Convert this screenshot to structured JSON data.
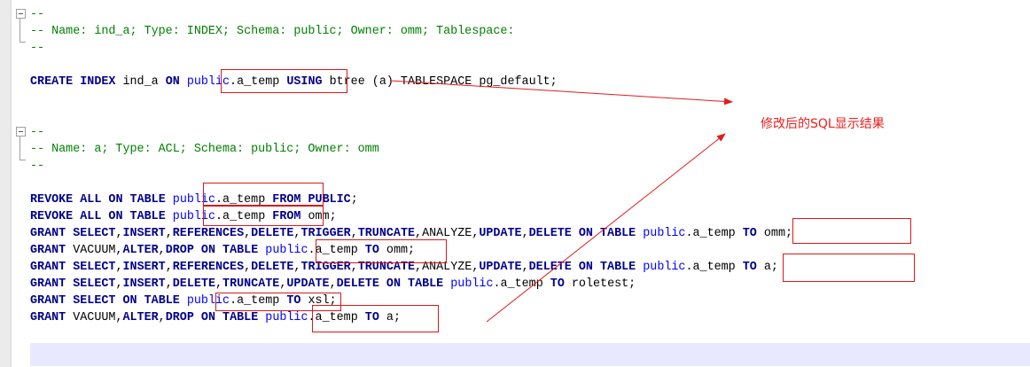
{
  "editor": {
    "lines": [
      {
        "row": 0,
        "tokens": [
          [
            "cm",
            "--"
          ]
        ]
      },
      {
        "row": 1,
        "tokens": [
          [
            "cm",
            "-- Name: ind_a; Type: INDEX; Schema: public; Owner: omm; Tablespace:"
          ]
        ]
      },
      {
        "row": 2,
        "tokens": [
          [
            "cm",
            "--"
          ]
        ]
      },
      {
        "row": 4,
        "tokens": [
          [
            "kw",
            "CREATE"
          ],
          [
            "pl",
            " "
          ],
          [
            "kw",
            "INDEX"
          ],
          [
            "pl",
            " ind_a "
          ],
          [
            "kw",
            "ON"
          ],
          [
            "pl",
            " "
          ],
          [
            "id",
            "public"
          ],
          [
            "pl",
            ".a_temp "
          ],
          [
            "kw",
            "USING"
          ],
          [
            "pl",
            " btree (a) TABLESPACE pg_default;"
          ]
        ]
      },
      {
        "row": 7,
        "tokens": [
          [
            "cm",
            "--"
          ]
        ]
      },
      {
        "row": 8,
        "tokens": [
          [
            "cm",
            "-- Name: a; Type: ACL; Schema: public; Owner: omm"
          ]
        ]
      },
      {
        "row": 9,
        "tokens": [
          [
            "cm",
            "--"
          ]
        ]
      },
      {
        "row": 11,
        "tokens": [
          [
            "kw",
            "REVOKE"
          ],
          [
            "pl",
            " "
          ],
          [
            "kw",
            "ALL"
          ],
          [
            "pl",
            " "
          ],
          [
            "kw",
            "ON"
          ],
          [
            "pl",
            " "
          ],
          [
            "kw",
            "TABLE"
          ],
          [
            "pl",
            " "
          ],
          [
            "id",
            "public"
          ],
          [
            "pl",
            ".a_temp "
          ],
          [
            "kw",
            "FROM"
          ],
          [
            "pl",
            " "
          ],
          [
            "kw",
            "PUBLIC"
          ],
          [
            "pl",
            ";"
          ]
        ]
      },
      {
        "row": 12,
        "tokens": [
          [
            "kw",
            "REVOKE"
          ],
          [
            "pl",
            " "
          ],
          [
            "kw",
            "ALL"
          ],
          [
            "pl",
            " "
          ],
          [
            "kw",
            "ON"
          ],
          [
            "pl",
            " "
          ],
          [
            "kw",
            "TABLE"
          ],
          [
            "pl",
            " "
          ],
          [
            "id",
            "public"
          ],
          [
            "pl",
            ".a_temp "
          ],
          [
            "kw",
            "FROM"
          ],
          [
            "pl",
            " omm;"
          ]
        ]
      },
      {
        "row": 13,
        "tokens": [
          [
            "kw",
            "GRANT"
          ],
          [
            "pl",
            " "
          ],
          [
            "kw",
            "SELECT"
          ],
          [
            "pl",
            ","
          ],
          [
            "kw",
            "INSERT"
          ],
          [
            "pl",
            ","
          ],
          [
            "kw",
            "REFERENCES"
          ],
          [
            "pl",
            ","
          ],
          [
            "kw",
            "DELETE"
          ],
          [
            "pl",
            ","
          ],
          [
            "kw",
            "TRIGGER"
          ],
          [
            "pl",
            ","
          ],
          [
            "kw",
            "TRUNCATE"
          ],
          [
            "pl",
            ",ANALYZE,"
          ],
          [
            "kw",
            "UPDATE"
          ],
          [
            "pl",
            ","
          ],
          [
            "kw",
            "DELETE"
          ],
          [
            "pl",
            " "
          ],
          [
            "kw",
            "ON"
          ],
          [
            "pl",
            " "
          ],
          [
            "kw",
            "TABLE"
          ],
          [
            "pl",
            " "
          ],
          [
            "id",
            "public"
          ],
          [
            "pl",
            ".a_temp "
          ],
          [
            "kw",
            "TO"
          ],
          [
            "pl",
            " omm;"
          ]
        ]
      },
      {
        "row": 14,
        "tokens": [
          [
            "kw",
            "GRANT"
          ],
          [
            "pl",
            " VACUUM,"
          ],
          [
            "kw",
            "ALTER"
          ],
          [
            "pl",
            ","
          ],
          [
            "kw",
            "DROP"
          ],
          [
            "pl",
            " "
          ],
          [
            "kw",
            "ON"
          ],
          [
            "pl",
            " "
          ],
          [
            "kw",
            "TABLE"
          ],
          [
            "pl",
            " "
          ],
          [
            "id",
            "public"
          ],
          [
            "pl",
            ".a_temp "
          ],
          [
            "kw",
            "TO"
          ],
          [
            "pl",
            " omm;"
          ]
        ]
      },
      {
        "row": 15,
        "tokens": [
          [
            "kw",
            "GRANT"
          ],
          [
            "pl",
            " "
          ],
          [
            "kw",
            "SELECT"
          ],
          [
            "pl",
            ","
          ],
          [
            "kw",
            "INSERT"
          ],
          [
            "pl",
            ","
          ],
          [
            "kw",
            "REFERENCES"
          ],
          [
            "pl",
            ","
          ],
          [
            "kw",
            "DELETE"
          ],
          [
            "pl",
            ","
          ],
          [
            "kw",
            "TRIGGER"
          ],
          [
            "pl",
            ","
          ],
          [
            "kw",
            "TRUNCATE"
          ],
          [
            "pl",
            ",ANALYZE,"
          ],
          [
            "kw",
            "UPDATE"
          ],
          [
            "pl",
            ","
          ],
          [
            "kw",
            "DELETE"
          ],
          [
            "pl",
            " "
          ],
          [
            "kw",
            "ON"
          ],
          [
            "pl",
            " "
          ],
          [
            "kw",
            "TABLE"
          ],
          [
            "pl",
            " "
          ],
          [
            "id",
            "public"
          ],
          [
            "pl",
            ".a_temp "
          ],
          [
            "kw",
            "TO"
          ],
          [
            "pl",
            " a;"
          ]
        ]
      },
      {
        "row": 16,
        "tokens": [
          [
            "kw",
            "GRANT"
          ],
          [
            "pl",
            " "
          ],
          [
            "kw",
            "SELECT"
          ],
          [
            "pl",
            ","
          ],
          [
            "kw",
            "INSERT"
          ],
          [
            "pl",
            ","
          ],
          [
            "kw",
            "DELETE"
          ],
          [
            "pl",
            ","
          ],
          [
            "kw",
            "TRUNCATE"
          ],
          [
            "pl",
            ","
          ],
          [
            "kw",
            "UPDATE"
          ],
          [
            "pl",
            ","
          ],
          [
            "kw",
            "DELETE"
          ],
          [
            "pl",
            " "
          ],
          [
            "kw",
            "ON"
          ],
          [
            "pl",
            " "
          ],
          [
            "kw",
            "TABLE"
          ],
          [
            "pl",
            " "
          ],
          [
            "id",
            "public"
          ],
          [
            "pl",
            ".a_temp "
          ],
          [
            "kw",
            "TO"
          ],
          [
            "pl",
            " roletest;"
          ]
        ]
      },
      {
        "row": 17,
        "tokens": [
          [
            "kw",
            "GRANT"
          ],
          [
            "pl",
            " "
          ],
          [
            "kw",
            "SELECT"
          ],
          [
            "pl",
            " "
          ],
          [
            "kw",
            "ON"
          ],
          [
            "pl",
            " "
          ],
          [
            "kw",
            "TABLE"
          ],
          [
            "pl",
            " "
          ],
          [
            "id",
            "public"
          ],
          [
            "pl",
            ".a_temp "
          ],
          [
            "kw",
            "TO"
          ],
          [
            "pl",
            " xsl;"
          ]
        ]
      },
      {
        "row": 18,
        "tokens": [
          [
            "kw",
            "GRANT"
          ],
          [
            "pl",
            " VACUUM,"
          ],
          [
            "kw",
            "ALTER"
          ],
          [
            "pl",
            ","
          ],
          [
            "kw",
            "DROP"
          ],
          [
            "pl",
            " "
          ],
          [
            "kw",
            "ON"
          ],
          [
            "pl",
            " "
          ],
          [
            "kw",
            "TABLE"
          ],
          [
            "pl",
            " "
          ],
          [
            "id",
            "public"
          ],
          [
            "pl",
            ".a_temp "
          ],
          [
            "kw",
            "TO"
          ],
          [
            "pl",
            " a;"
          ]
        ]
      }
    ]
  },
  "annotation": {
    "text": "修改后的SQL显示结果",
    "color": "#ee1c1c"
  },
  "highlight_color": "#d9191b"
}
